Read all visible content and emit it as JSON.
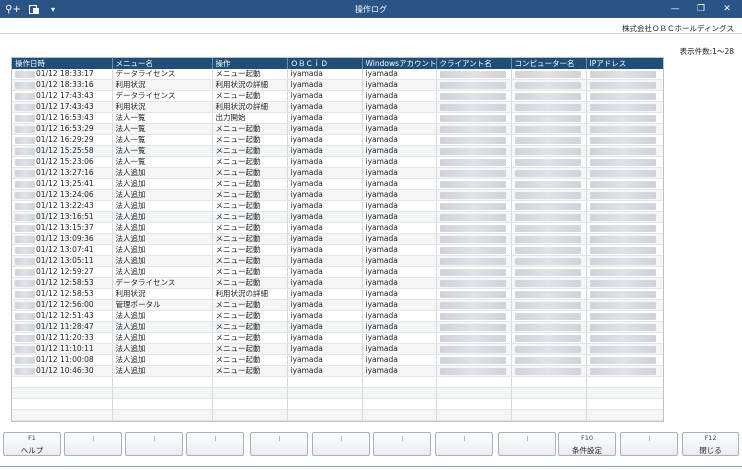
{
  "window": {
    "title": "操作ログ",
    "minimize": "—",
    "restore": "❐",
    "close": "✕",
    "tool_icons": [
      "search-add-icon",
      "export-icon",
      "dropdown-icon"
    ]
  },
  "header": {
    "company": "株式会社ＯＢＣホールディングス",
    "record_count": "表示件数:1～28"
  },
  "table": {
    "columns": [
      "操作日時",
      "メニュー名",
      "操作",
      "ＯＢＣｉＤ",
      "Windowsアカウント",
      "クライアント名",
      "コンピューター名",
      "IPアドレス"
    ],
    "rows": [
      {
        "datetime": "01/12 18:33:17",
        "menu": "データライセンス",
        "op": "メニュー起動",
        "obcid": "iyamada",
        "win": "iyamada"
      },
      {
        "datetime": "01/12 18:33:16",
        "menu": "利用状況",
        "op": "利用状況の詳細",
        "obcid": "iyamada",
        "win": "iyamada"
      },
      {
        "datetime": "01/12 17:43:43",
        "menu": "データライセンス",
        "op": "メニュー起動",
        "obcid": "iyamada",
        "win": "iyamada"
      },
      {
        "datetime": "01/12 17:43:43",
        "menu": "利用状況",
        "op": "利用状況の詳細",
        "obcid": "iyamada",
        "win": "iyamada"
      },
      {
        "datetime": "01/12 16:53:43",
        "menu": "法人一覧",
        "op": "出力開始",
        "obcid": "iyamada",
        "win": "iyamada"
      },
      {
        "datetime": "01/12 16:53:29",
        "menu": "法人一覧",
        "op": "メニュー起動",
        "obcid": "iyamada",
        "win": "iyamada"
      },
      {
        "datetime": "01/12 16:29:29",
        "menu": "法人一覧",
        "op": "メニュー起動",
        "obcid": "iyamada",
        "win": "iyamada"
      },
      {
        "datetime": "01/12 15:25:58",
        "menu": "法人一覧",
        "op": "メニュー起動",
        "obcid": "iyamada",
        "win": "iyamada"
      },
      {
        "datetime": "01/12 15:23:06",
        "menu": "法人一覧",
        "op": "メニュー起動",
        "obcid": "iyamada",
        "win": "iyamada"
      },
      {
        "datetime": "01/12 13:27:16",
        "menu": "法人追加",
        "op": "メニュー起動",
        "obcid": "iyamada",
        "win": "iyamada"
      },
      {
        "datetime": "01/12 13:25:41",
        "menu": "法人追加",
        "op": "メニュー起動",
        "obcid": "iyamada",
        "win": "iyamada"
      },
      {
        "datetime": "01/12 13:24:06",
        "menu": "法人追加",
        "op": "メニュー起動",
        "obcid": "iyamada",
        "win": "iyamada"
      },
      {
        "datetime": "01/12 13:22:43",
        "menu": "法人追加",
        "op": "メニュー起動",
        "obcid": "iyamada",
        "win": "iyamada"
      },
      {
        "datetime": "01/12 13:16:51",
        "menu": "法人追加",
        "op": "メニュー起動",
        "obcid": "iyamada",
        "win": "iyamada"
      },
      {
        "datetime": "01/12 13:15:37",
        "menu": "法人追加",
        "op": "メニュー起動",
        "obcid": "iyamada",
        "win": "iyamada"
      },
      {
        "datetime": "01/12 13:09:36",
        "menu": "法人追加",
        "op": "メニュー起動",
        "obcid": "iyamada",
        "win": "iyamada"
      },
      {
        "datetime": "01/12 13:07:41",
        "menu": "法人追加",
        "op": "メニュー起動",
        "obcid": "iyamada",
        "win": "iyamada"
      },
      {
        "datetime": "01/12 13:05:11",
        "menu": "法人追加",
        "op": "メニュー起動",
        "obcid": "iyamada",
        "win": "iyamada"
      },
      {
        "datetime": "01/12 12:59:27",
        "menu": "法人追加",
        "op": "メニュー起動",
        "obcid": "iyamada",
        "win": "iyamada"
      },
      {
        "datetime": "01/12 12:58:53",
        "menu": "データライセンス",
        "op": "メニュー起動",
        "obcid": "iyamada",
        "win": "iyamada"
      },
      {
        "datetime": "01/12 12:58:53",
        "menu": "利用状況",
        "op": "利用状況の詳細",
        "obcid": "iyamada",
        "win": "iyamada"
      },
      {
        "datetime": "01/12 12:56:00",
        "menu": "管理ポータル",
        "op": "メニュー起動",
        "obcid": "iyamada",
        "win": "iyamada"
      },
      {
        "datetime": "01/12 12:51:43",
        "menu": "法人追加",
        "op": "メニュー起動",
        "obcid": "iyamada",
        "win": "iyamada"
      },
      {
        "datetime": "01/12 11:28:47",
        "menu": "法人追加",
        "op": "メニュー起動",
        "obcid": "iyamada",
        "win": "iyamada"
      },
      {
        "datetime": "01/12 11:20:33",
        "menu": "法人追加",
        "op": "メニュー起動",
        "obcid": "iyamada",
        "win": "iyamada"
      },
      {
        "datetime": "01/12 11:10:11",
        "menu": "法人追加",
        "op": "メニュー起動",
        "obcid": "iyamada",
        "win": "iyamada"
      },
      {
        "datetime": "01/12 11:00:08",
        "menu": "法人追加",
        "op": "メニュー起動",
        "obcid": "iyamada",
        "win": "iyamada"
      },
      {
        "datetime": "01/12 10:46:30",
        "menu": "法人追加",
        "op": "メニュー起動",
        "obcid": "iyamada",
        "win": "iyamada"
      }
    ]
  },
  "function_keys": [
    {
      "key": "F1",
      "label": "ヘルプ"
    },
    {
      "key": "",
      "label": ""
    },
    {
      "key": "",
      "label": ""
    },
    {
      "key": "",
      "label": ""
    },
    {
      "key": "",
      "label": ""
    },
    {
      "key": "",
      "label": ""
    },
    {
      "key": "",
      "label": ""
    },
    {
      "key": "",
      "label": ""
    },
    {
      "key": "",
      "label": ""
    },
    {
      "key": "F10",
      "label": "条件設定"
    },
    {
      "key": "",
      "label": ""
    },
    {
      "key": "F12",
      "label": "閉じる"
    }
  ]
}
